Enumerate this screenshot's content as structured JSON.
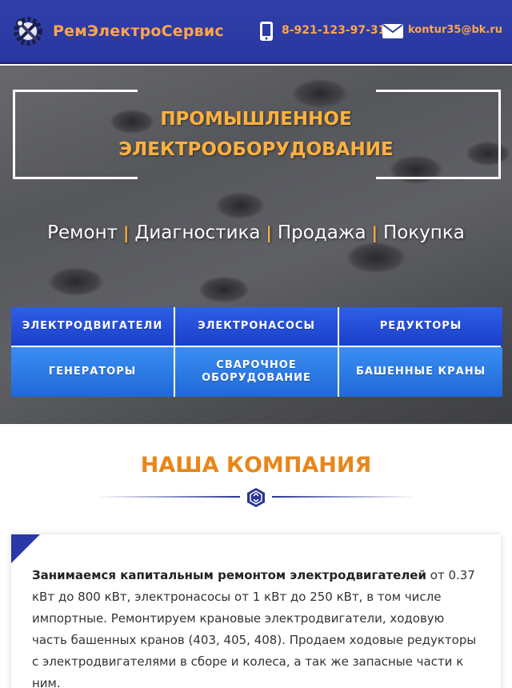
{
  "header": {
    "logo_text": "РемЭлектроСервис",
    "phone": "8-921-123-97-31",
    "email": "kontur35@bk.ru",
    "colors": {
      "background": "#2e3aa6",
      "accent": "#ffa64a"
    },
    "icons": [
      "gear-wrench-logo-icon",
      "phone-icon",
      "mail-icon"
    ]
  },
  "hero": {
    "title_line1": "ПРОМЫШЛЕННОЕ",
    "title_line2": "ЭЛЕКТРООБОРУДОВАНИЕ",
    "services": [
      "Ремонт",
      "Диагностика",
      "Продажа",
      "Покупка"
    ],
    "separator": "|",
    "categories": [
      "ЭЛЕКТРОДВИГАТЕЛИ",
      "ЭЛЕКТРОНАСОСЫ",
      "РЕДУКТОРЫ",
      "ГЕНЕРАТОРЫ",
      "СВАРОЧНОЕ ОБОРУДОВАНИЕ",
      "БАШЕННЫЕ КРАНЫ"
    ],
    "colors": {
      "title": "#ffb13d",
      "category_bg": "#2456e0"
    }
  },
  "company": {
    "title": "НАША КОМПАНИЯ",
    "divider_icon": "hexagon-arrows-icon",
    "text_bold": "Занимаемся капитальным ремонтом электродвигателей",
    "text_rest": " от 0.37 кВт до 800 кВт, электронасосы от 1 кВт до 250 кВт, в том числе импортные. Ремонтируем крановые электродвигатели, ходовую часть башенных кранов (403, 405, 408). Продаем ходовые редукторы с электродвигателями в сборе и колеса, а так же запасные части к ним.",
    "colors": {
      "title": "#e8861a",
      "corner": "#2b38a8"
    }
  }
}
